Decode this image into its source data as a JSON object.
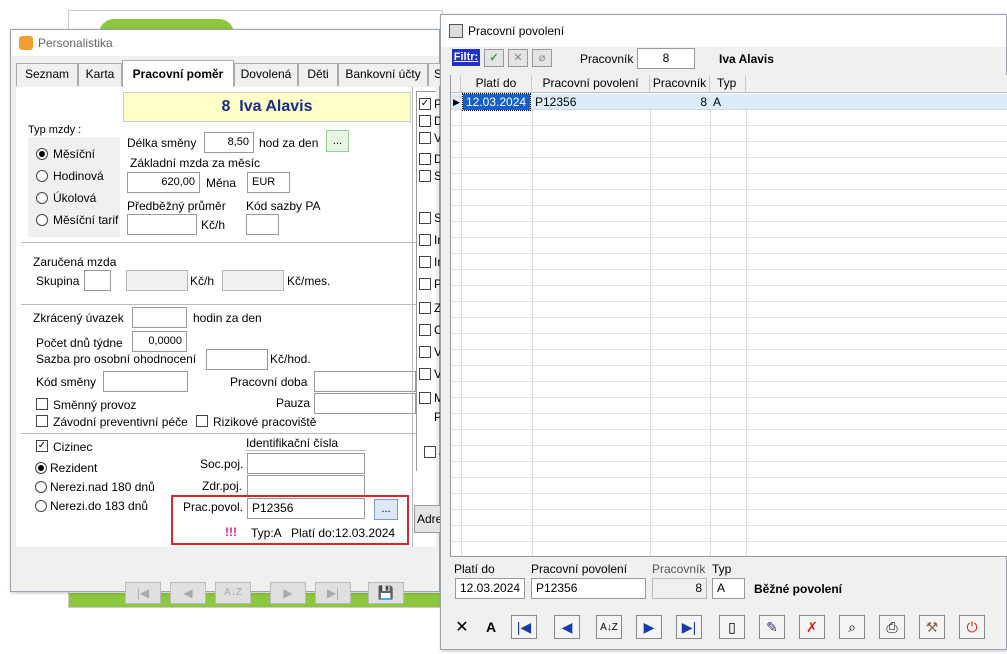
{
  "left_window": {
    "title": "Personalistika",
    "tabs": [
      "Seznam",
      "Karta",
      "Pracovní poměr",
      "Dovolená",
      "Děti",
      "Bankovní účty",
      "S"
    ],
    "header": {
      "number": "8",
      "name": "Iva Alavis"
    },
    "typ_mzdy": {
      "label": "Typ mzdy :",
      "options": [
        "Měsíční",
        "Hodinová",
        "Úkolová",
        "Měsíční tarif"
      ],
      "selected": "Měsíční"
    },
    "delka_smeny": {
      "label": "Délka směny",
      "value": "8,50",
      "unit": "hod za den",
      "button": "..."
    },
    "zakladni_mzda": {
      "label": "Základní mzda za měsíc",
      "value": "620,00",
      "mena_label": "Měna",
      "mena_value": "EUR"
    },
    "predbezny_prumer": {
      "label": "Předběžný průměr",
      "value": "",
      "unit": "Kč/h"
    },
    "kod_sazby": {
      "label": "Kód sazby PA",
      "value": ""
    },
    "zarucena_mzda": {
      "label": "Zaručená mzda",
      "skupina_label": "Skupina",
      "skupina_value": "",
      "kch_value": "",
      "kch_unit": "Kč/h",
      "kcmes_value": "",
      "kcmes_unit": "Kč/mes."
    },
    "zkraceny_uvazek": {
      "label": "Zkrácený úvazek",
      "value": "",
      "unit": "hodin za den"
    },
    "pocet_dnu": {
      "label": "Počet dnů  týdne",
      "value": "0,0000"
    },
    "sazba_ohodnoceni": {
      "label": "Sazba pro osobní ohodnocení",
      "value": "",
      "unit": "Kč/hod."
    },
    "kod_smeny": {
      "label": "Kód směny",
      "value": ""
    },
    "pracovni_doba": {
      "label": "Pracovní doba",
      "value": ""
    },
    "pauza": {
      "label": "Pauza",
      "value": ""
    },
    "checkboxes": {
      "smenny_provoz": "Směnný provoz",
      "zavodni_pece": "Závodní preventivní péče",
      "rizikove": "Rizikové pracoviště"
    },
    "cizinec": {
      "label": "Cizinec",
      "checked": true,
      "options": [
        "Rezident",
        "Nerezi.nad 180 dnů",
        "Nerezi.do 183 dnů"
      ],
      "selected": "Rezident"
    },
    "identifikacni": {
      "label": "Identifikační čísla",
      "soc_label": "Soc.poj.",
      "soc_value": "",
      "zdr_label": "Zdr.poj.",
      "zdr_value": "",
      "prac_label": "Prac.povol.",
      "prac_value": "P12356",
      "prac_button": "..."
    },
    "warning": {
      "marks": "!!!",
      "text": "Typ:A   Platí do:12.03.2024"
    },
    "right_column_checked": "P",
    "right_column_letters": [
      "D",
      "V",
      "D",
      "S",
      "S",
      "In",
      "In",
      "P",
      "Z",
      "O",
      "V",
      "V",
      "M",
      "P",
      "J"
    ],
    "adresa_button": "Adre",
    "nav_icons": [
      "first-icon",
      "prev-icon",
      "sort-icon",
      "next-icon",
      "last-icon",
      "save-icon"
    ]
  },
  "right_window": {
    "title": "Pracovní povolení",
    "filter_label": "Filtr:",
    "pracovnik_label": "Pracovník",
    "pracovnik_value": "8",
    "pracovnik_name": "Iva Alavis",
    "columns": [
      "Platí do",
      "Pracovní povolení",
      "Pracovník",
      "Typ"
    ],
    "rows": [
      {
        "plati_do": "12.03.2024",
        "povoleni": "P12356",
        "pracovnik": "8",
        "typ": "A"
      }
    ],
    "detail": {
      "plati_do_label": "Platí do",
      "plati_do_value": "12.03.2024",
      "povoleni_label": "Pracovní povolení",
      "povoleni_value": "P12356",
      "pracovnik_label": "Pracovník",
      "pracovnik_value": "8",
      "typ_label": "Typ",
      "typ_value": "A",
      "typ_desc": "Běžné povolení"
    },
    "toolbar_icons": [
      "close-icon",
      "font-icon",
      "first-icon",
      "prev-icon",
      "sort-icon",
      "next-icon",
      "last-icon",
      "new-icon",
      "edit-icon",
      "delete-icon",
      "search-icon",
      "print-icon",
      "tools-icon",
      "power-icon"
    ]
  }
}
